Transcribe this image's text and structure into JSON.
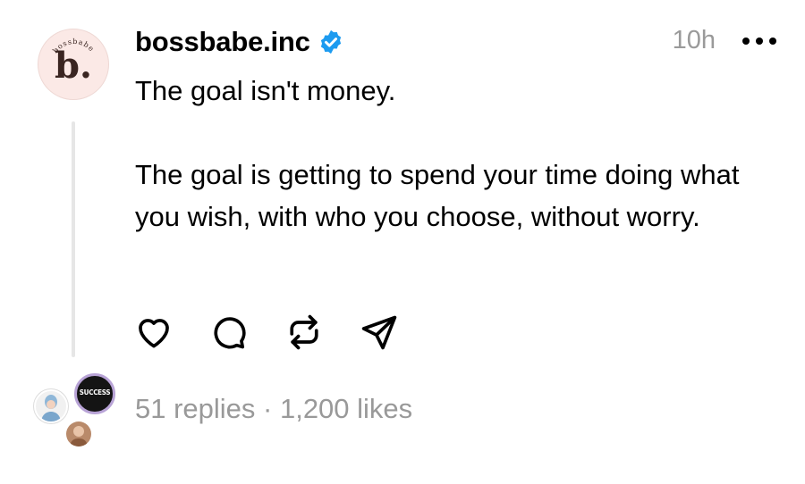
{
  "post": {
    "author": {
      "username": "bossbabe.inc",
      "avatar_letter": "b.",
      "avatar_ring_text": "bossbabe",
      "verified": true
    },
    "timestamp": "10h",
    "text": "The goal isn't money.\n\nThe goal is getting to spend your time doing what you wish, with who you choose, without worry.",
    "actions": [
      {
        "name": "like",
        "icon": "heart-icon"
      },
      {
        "name": "reply",
        "icon": "comment-icon"
      },
      {
        "name": "repost",
        "icon": "repost-icon"
      },
      {
        "name": "share",
        "icon": "send-icon"
      }
    ],
    "replier_avatars": [
      {
        "label": ""
      },
      {
        "label": "SUCCESS"
      },
      {
        "label": ""
      }
    ],
    "stats": "51 replies · 1,200 likes"
  },
  "colors": {
    "verified_badge": "#1d9bf0",
    "muted_text": "#999999",
    "avatar_bg": "#fbe9e6"
  }
}
